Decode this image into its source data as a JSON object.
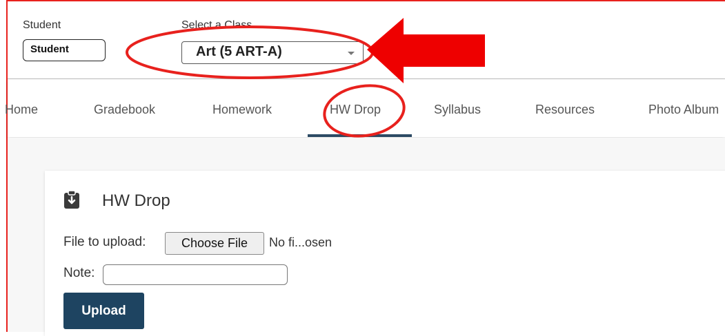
{
  "header": {
    "student_label": "Student",
    "student_value": "Student",
    "class_label": "Select a Class",
    "class_selected": "Art (5 ART-A)"
  },
  "nav": {
    "items": [
      {
        "label": "Home"
      },
      {
        "label": "Gradebook"
      },
      {
        "label": "Homework"
      },
      {
        "label": "HW Drop",
        "active": true
      },
      {
        "label": "Syllabus"
      },
      {
        "label": "Resources"
      },
      {
        "label": "Photo Album"
      }
    ]
  },
  "card": {
    "icon": "clipboard-download-icon",
    "title": "HW Drop",
    "file_label": "File to upload:",
    "choose_button": "Choose File",
    "file_status": "No fi...osen",
    "note_label": "Note:",
    "note_value": "",
    "upload_button": "Upload"
  },
  "colors": {
    "annotation_red": "#e8211d",
    "nav_active": "#2c4a64",
    "upload_button": "#1e4461"
  }
}
